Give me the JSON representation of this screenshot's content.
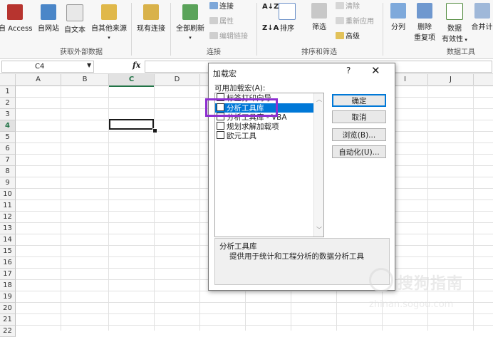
{
  "ribbon": {
    "external_data": {
      "group_label": "获取外部数据",
      "buttons": [
        "自 Access",
        "自网站",
        "自文本",
        "自其他来源",
        "现有连接"
      ]
    },
    "connections": {
      "group_label": "连接",
      "refresh_all": "全部刷新",
      "connections": "连接",
      "properties": "属性",
      "edit_links": "编辑链接"
    },
    "sort_filter": {
      "group_label": "排序和筛选",
      "sort": "排序",
      "filter": "筛选",
      "clear": "清除",
      "reapply": "重新应用",
      "advanced": "高级"
    },
    "data_tools": {
      "group_label": "数据工具",
      "text_to_columns": "分列",
      "remove_duplicates_line1": "删除",
      "remove_duplicates_line2": "重复项",
      "data_validation_line1": "数据",
      "data_validation_line2": "有效性",
      "consolidate": "合并计"
    }
  },
  "formula_bar": {
    "name_box": "C4",
    "fx": "fx",
    "formula": ""
  },
  "grid": {
    "columns": [
      "A",
      "B",
      "C",
      "D",
      "E",
      "F",
      "G",
      "H",
      "I",
      "J"
    ],
    "rows": [
      "1",
      "2",
      "3",
      "4",
      "5",
      "6",
      "7",
      "8",
      "9",
      "10",
      "11",
      "12",
      "13",
      "14",
      "15",
      "16",
      "17",
      "18",
      "19",
      "20",
      "21",
      "22"
    ],
    "selected_column": "C",
    "selected_row": "4"
  },
  "dialog": {
    "title": "加载宏",
    "help": "?",
    "close": "✕",
    "available_label": "可用加载宏(A):",
    "addins": [
      {
        "label": "标签打印向导",
        "checked": false,
        "selected": false
      },
      {
        "label": "分析工具库",
        "checked": false,
        "selected": true
      },
      {
        "label": "分析工具库 - VBA",
        "checked": false,
        "selected": false
      },
      {
        "label": "规划求解加载项",
        "checked": false,
        "selected": false
      },
      {
        "label": "欧元工具",
        "checked": false,
        "selected": false
      }
    ],
    "buttons": {
      "ok": "确定",
      "cancel": "取消",
      "browse": "浏览(B)...",
      "automation": "自动化(U)..."
    },
    "description_title": "分析工具库",
    "description_text": "提供用于统计和工程分析的数据分析工具"
  },
  "watermark": {
    "text": "搜狗指南",
    "url": "zhinan.sogou.com"
  },
  "colors": {
    "accent_selection": "#0078d7",
    "highlight_box": "#8e2fd0",
    "excel_green": "#217346"
  }
}
